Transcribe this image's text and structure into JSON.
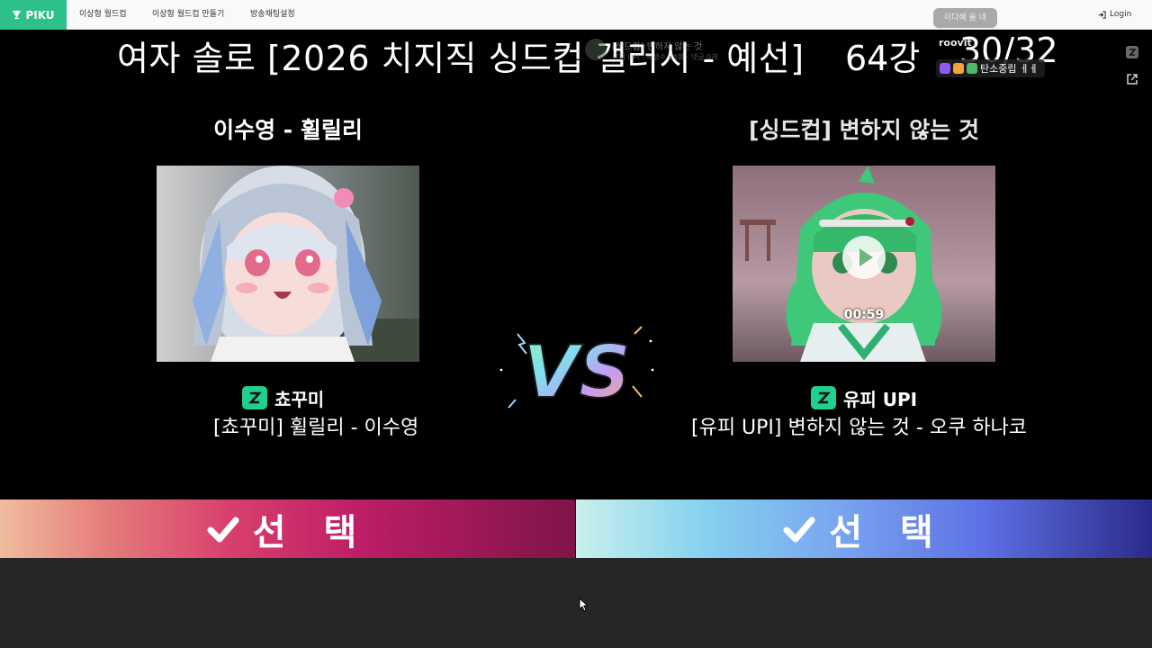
{
  "nav": {
    "brand": "PIKU",
    "links": [
      "이상형 월드컵",
      "이상형 월드컵 만들기",
      "방송채팅설정"
    ],
    "pill": "이다혜 올 네",
    "login": "Login"
  },
  "game": {
    "title": "여자 솔로 [2026 치지직 싱드컵 갤러시 - 예선]",
    "round": "64강",
    "counter": "30/32"
  },
  "overlay": {
    "stream_line1": "[싱드컵] 변하지 않는 것",
    "stream_line2": "유피 UPI · 재생수 64회 · 댓글 0개",
    "roovit": "roovit",
    "chat_badge": "탄소중립 ㅔㅔ"
  },
  "left": {
    "title": "이수영 - 휠릴리",
    "channel": "쵸꾸미",
    "video_title": "[쵸꾸미] 휠릴리 - 이수영"
  },
  "right": {
    "title": "[싱드컵] 변하지 않는 것",
    "duration": "00:59",
    "channel": "유피 UPI",
    "video_title": "[유피 UPI] 변하지 않는 것 - 오쿠 하나코"
  },
  "vs": "VS",
  "select": {
    "left_label": "선 택",
    "right_label": "선 택"
  },
  "colors": {
    "brand": "#2ec08a",
    "chzzk_green": "#1fd18f",
    "select_left": "#d83f6c",
    "select_right": "#5e72e6"
  },
  "icons": [
    "trophy-icon",
    "login-icon",
    "chzzk-icon",
    "checkmark-icon",
    "play-icon",
    "external-link-icon"
  ]
}
